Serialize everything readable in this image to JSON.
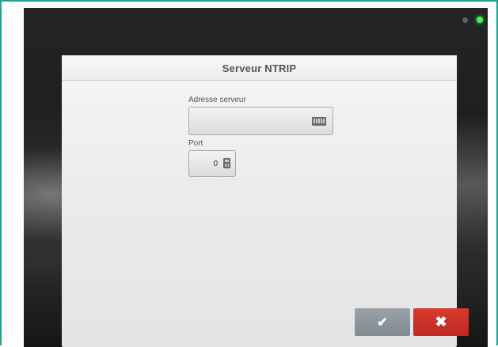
{
  "dialog": {
    "title": "Serveur NTRIP"
  },
  "fields": {
    "server_address": {
      "label": "Adresse serveur",
      "value": "",
      "icon": "keyboard-icon"
    },
    "port": {
      "label": "Port",
      "value": "0",
      "icon": "calculator-icon"
    }
  },
  "buttons": {
    "confirm": {
      "icon": "checkmark-icon",
      "glyph": "✔",
      "color": "#8a9398"
    },
    "cancel": {
      "icon": "close-icon",
      "glyph": "✖",
      "color": "#cc3328"
    }
  },
  "indicators": {
    "led_grey": "#5d6163",
    "led_green": "#42f54a"
  },
  "colors": {
    "frame_border": "#1fa38e"
  }
}
